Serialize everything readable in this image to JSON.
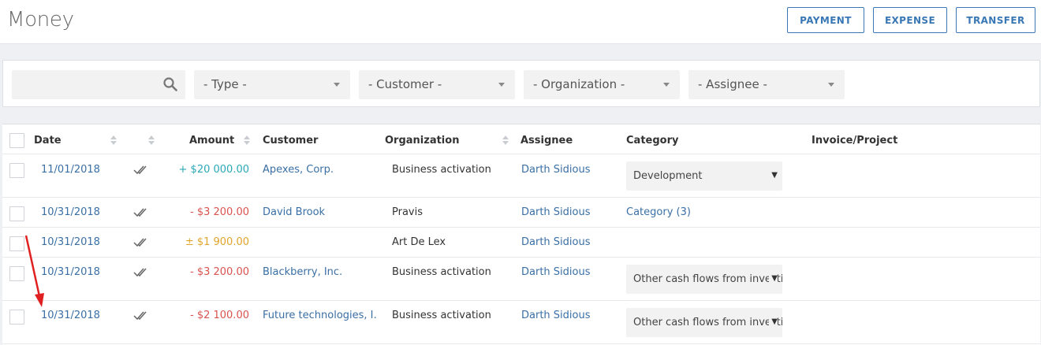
{
  "header": {
    "title": "Money",
    "buttons": {
      "payment": "PAYMENT",
      "expense": "EXPENSE",
      "transfer": "TRANSFER"
    }
  },
  "filters": {
    "search": {
      "value": "",
      "placeholder": ""
    },
    "type": "- Type -",
    "customer": "- Customer -",
    "organization": "- Organization -",
    "assignee": "- Assignee -"
  },
  "table": {
    "columns": {
      "date": "Date",
      "amount": "Amount",
      "customer": "Customer",
      "organization": "Organization",
      "assignee": "Assignee",
      "category": "Category",
      "invoice": "Invoice/Project"
    },
    "rows": [
      {
        "date": "11/01/2018",
        "amount": "+ $20 000.00",
        "customer": "Apexes, Corp.",
        "organization": "Business activation",
        "assignee": "Darth Sidious",
        "category": "Development"
      },
      {
        "date": "10/31/2018",
        "amount": "- $3 200.00",
        "customer": "David Brook",
        "organization": "Pravis",
        "assignee": "Darth Sidious",
        "category": "Category (3)"
      },
      {
        "date": "10/31/2018",
        "amount": "± $1 900.00",
        "customer": "",
        "organization": "Art De Lex",
        "assignee": "Darth Sidious",
        "category": ""
      },
      {
        "date": "10/31/2018",
        "amount": "- $3 200.00",
        "customer": "Blackberry, Inc.",
        "organization": "Business activation",
        "assignee": "Darth Sidious",
        "category": "Other cash flows from investing"
      },
      {
        "date": "10/31/2018",
        "amount": "- $2 100.00",
        "customer": "Future technologies, I…",
        "organization": "Business activation",
        "assignee": "Darth Sidious",
        "category": "Other cash flows from investing"
      }
    ]
  },
  "colors": {
    "accent": "#3a77b5",
    "positive": "#2aa8b8",
    "negative": "#d9534f",
    "neutral": "#e0a52c",
    "annotation": "#e02020"
  },
  "icons": {
    "search": "search-icon",
    "reconciled": "double-check-icon",
    "sort": "sort-arrows-icon",
    "dropdown": "chevron-down-icon"
  }
}
